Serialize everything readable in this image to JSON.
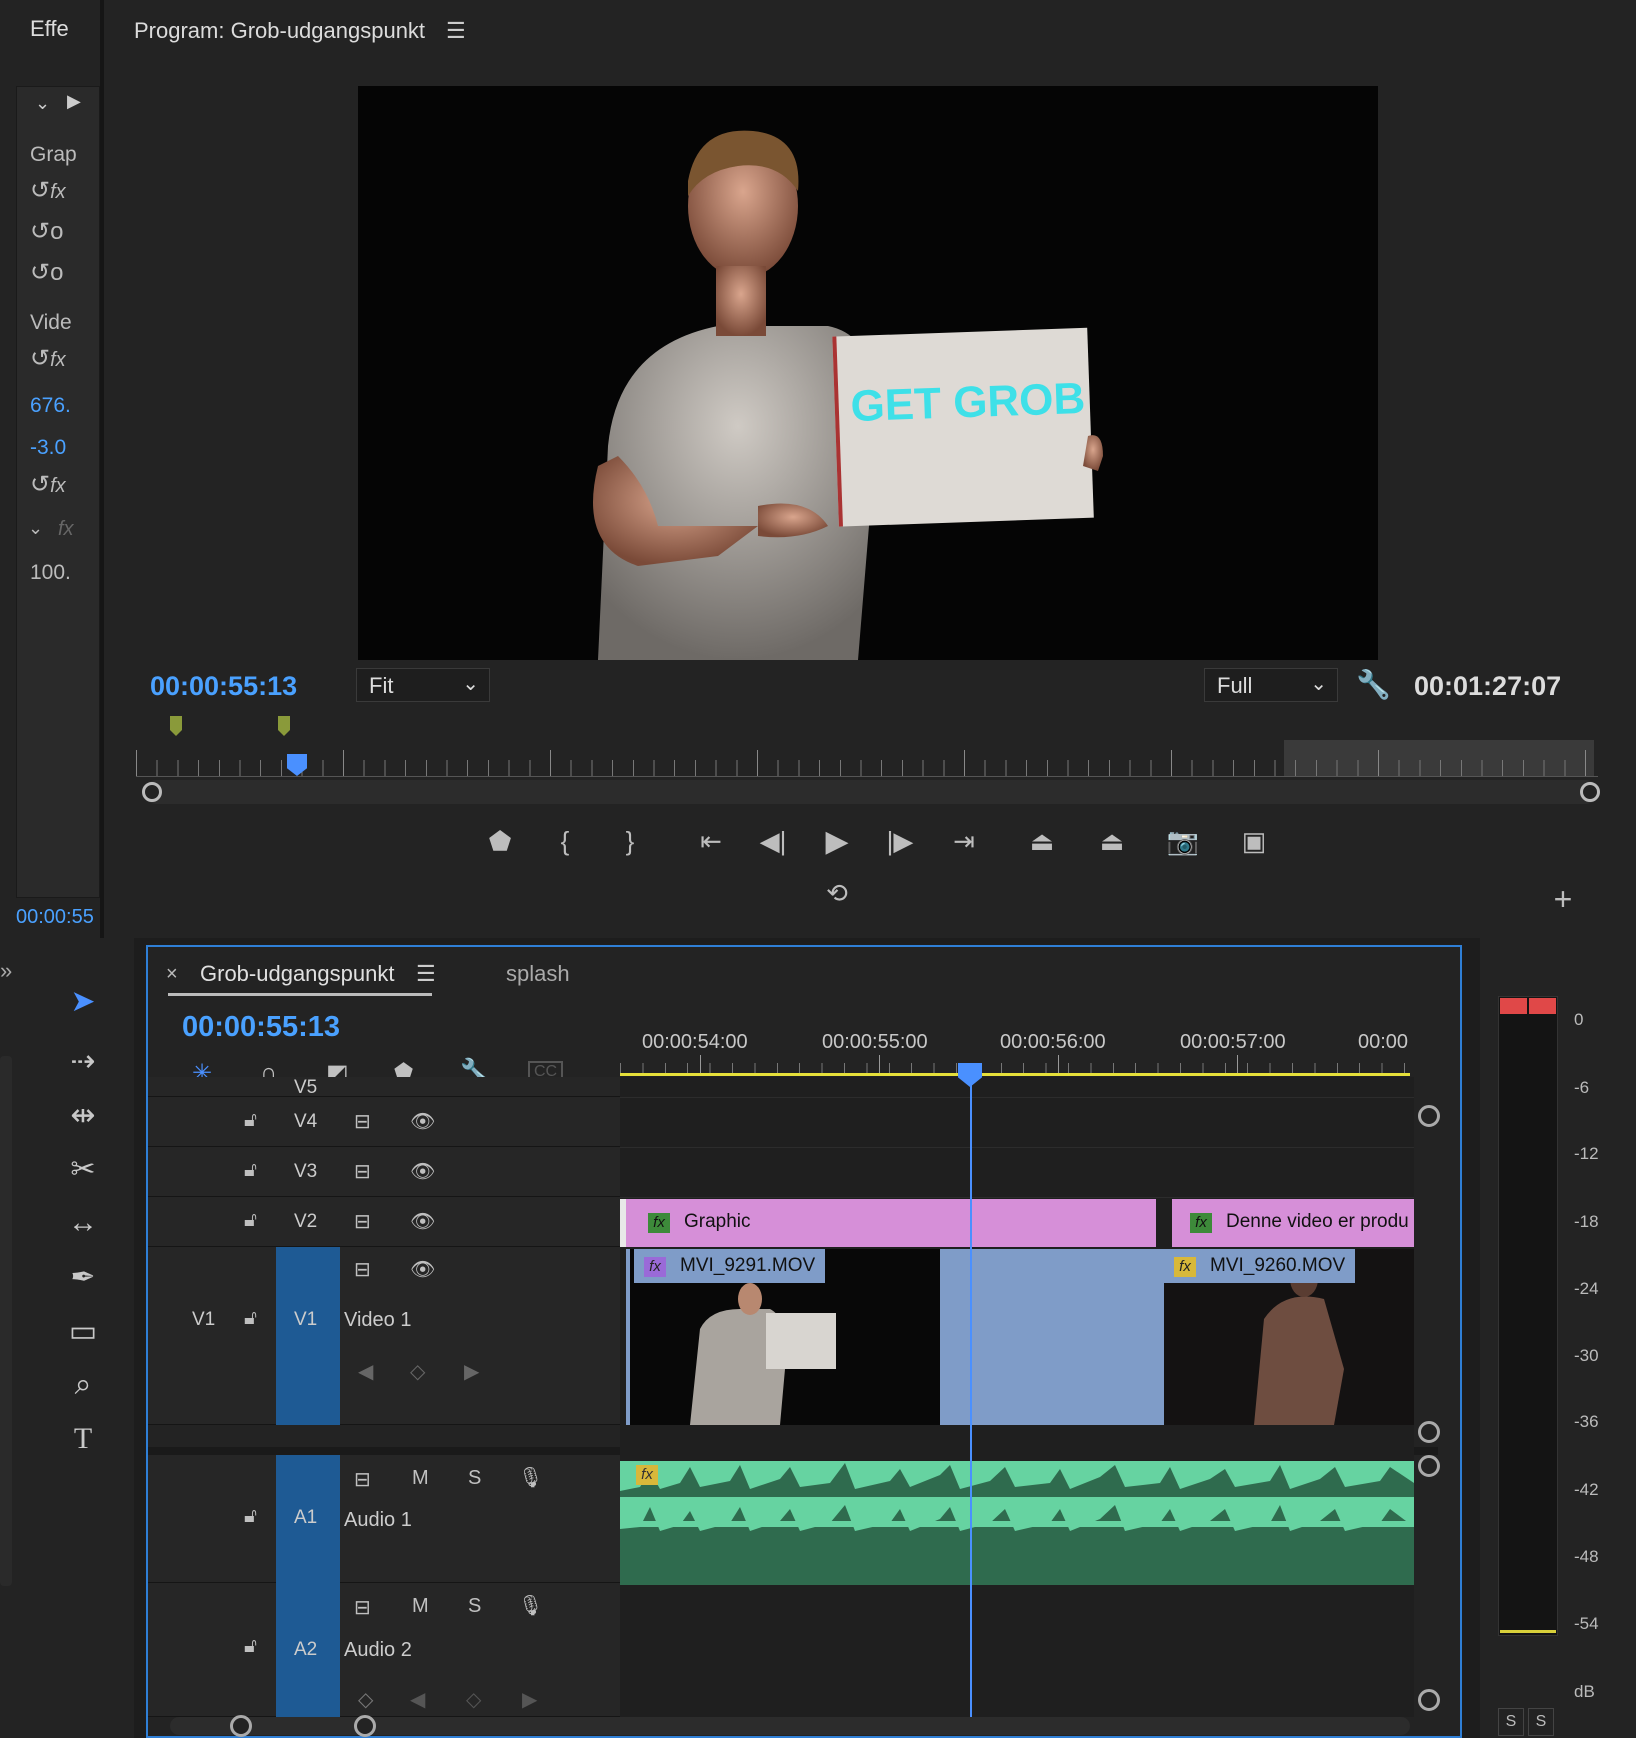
{
  "effects_panel": {
    "tab": "Effe",
    "rows": [
      "Grap",
      "Vide",
      "676.",
      "-3.0",
      "100."
    ],
    "timecode": "00:00:55"
  },
  "program": {
    "title": "Program: Grob-udgangspunkt",
    "sign_text": "GET GROB",
    "timecode": "00:00:55:13",
    "fit": "Fit",
    "quality": "Full",
    "duration": "00:01:27:07"
  },
  "timeline": {
    "tab_active": "Grob-udgangspunkt",
    "tab_other": "splash",
    "timecode": "00:00:55:13",
    "ruler": [
      "00:00:54:00",
      "00:00:55:00",
      "00:00:56:00",
      "00:00:57:00",
      "00:00"
    ],
    "tracks": {
      "v5": "V5",
      "v4": "V4",
      "v3": "V3",
      "v2": "V2",
      "v1_src": "V1",
      "v1": "V1",
      "v1_name": "Video 1",
      "a1": "A1",
      "a1_name": "Audio 1",
      "a2": "A2",
      "a2_name": "Audio 2",
      "m": "M",
      "s": "S"
    },
    "clips": {
      "graphic": "Graphic",
      "denne": "Denne video er produ",
      "mvi1": "MVI_9291.MOV",
      "mvi2": "MVI_9260.MOV"
    }
  },
  "meter": {
    "labels": [
      "0",
      "-6",
      "-12",
      "-18",
      "-24",
      "-30",
      "-36",
      "-42",
      "-48",
      "-54",
      "dB"
    ],
    "solo": [
      "S",
      "S"
    ]
  },
  "icons": [
    "selection-tool-icon",
    "track-select-icon",
    "ripple-edit-icon",
    "razor-icon",
    "slip-icon",
    "pen-icon",
    "rectangle-icon",
    "zoom-icon",
    "type-icon",
    "wrench-icon",
    "camera-icon",
    "lock-icon",
    "eye-icon",
    "mic-icon",
    "play-icon",
    "marker-icon"
  ]
}
